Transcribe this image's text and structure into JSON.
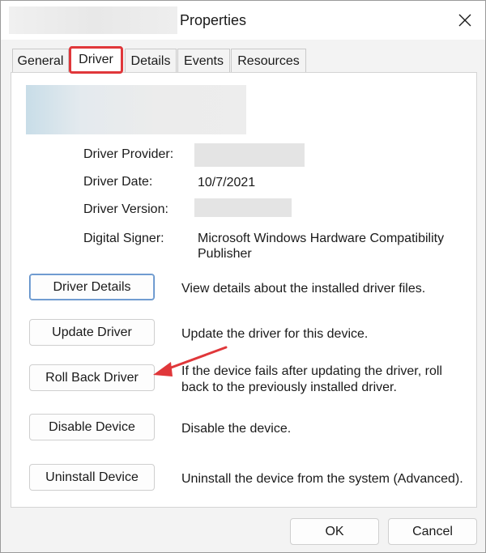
{
  "window": {
    "title": "Properties",
    "close_icon": "close-icon"
  },
  "tabs": [
    {
      "label": "General"
    },
    {
      "label": "Driver",
      "active": true
    },
    {
      "label": "Details"
    },
    {
      "label": "Events"
    },
    {
      "label": "Resources"
    }
  ],
  "info": {
    "provider_label": "Driver Provider:",
    "date_label": "Driver Date:",
    "date_value": "10/7/2021",
    "version_label": "Driver Version:",
    "signer_label": "Digital Signer:",
    "signer_value": "Microsoft Windows Hardware Compatibility Publisher"
  },
  "actions": [
    {
      "label": "Driver Details",
      "description": "View details about the installed driver files."
    },
    {
      "label": "Update Driver",
      "description": "Update the driver for this device."
    },
    {
      "label": "Roll Back Driver",
      "description": "If the device fails after updating the driver, roll back to the previously installed driver."
    },
    {
      "label": "Disable Device",
      "description": "Disable the device."
    },
    {
      "label": "Uninstall Device",
      "description": "Uninstall the device from the system (Advanced)."
    }
  ],
  "footer": {
    "ok_label": "OK",
    "cancel_label": "Cancel"
  },
  "colors": {
    "annotation_red": "#e0373a",
    "focus_blue": "#5f8fc8"
  }
}
